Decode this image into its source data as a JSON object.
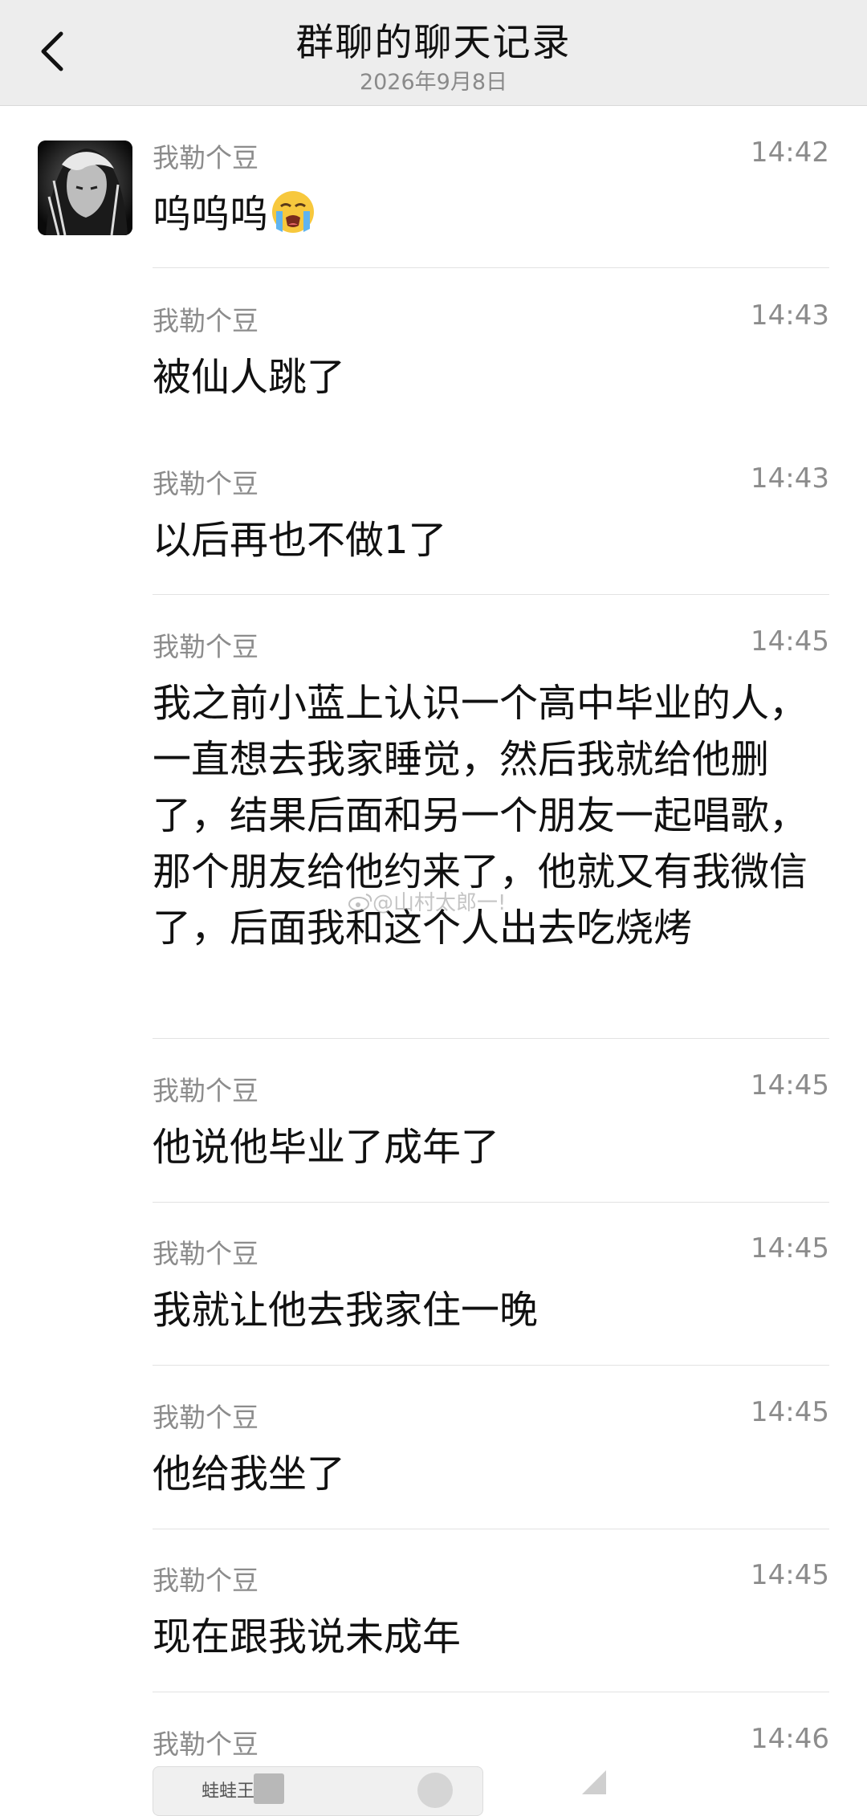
{
  "header": {
    "title": "群聊的聊天记录",
    "date": "2026年9月8日"
  },
  "messages": [
    {
      "sender": "我勒个豆",
      "time": "14:42",
      "text": "呜呜呜",
      "emoji": "loudly-crying-face"
    },
    {
      "sender": "我勒个豆",
      "time": "14:43",
      "text": "被仙人跳了"
    },
    {
      "sender": "我勒个豆",
      "time": "14:43",
      "text": "以后再也不做1了"
    },
    {
      "sender": "我勒个豆",
      "time": "14:45",
      "text": "我之前小蓝上认识一个高中毕业的人，一直想去我家睡觉，然后我就给他删了，结果后面和另一个朋友一起唱歌，那个朋友给他约来了，他就又有我微信了，后面我和这个人出去吃烧烤"
    },
    {
      "sender": "我勒个豆",
      "time": "14:45",
      "text": "他说他毕业了成年了"
    },
    {
      "sender": "我勒个豆",
      "time": "14:45",
      "text": "我就让他去我家住一晚"
    },
    {
      "sender": "我勒个豆",
      "time": "14:45",
      "text": "他给我坐了"
    },
    {
      "sender": "我勒个豆",
      "time": "14:45",
      "text": "现在跟我说未成年"
    },
    {
      "sender": "我勒个豆",
      "time": "14:46",
      "text": ""
    }
  ],
  "watermark": "@山村太郎一!",
  "preview": {
    "text": "蛙蛙王"
  }
}
